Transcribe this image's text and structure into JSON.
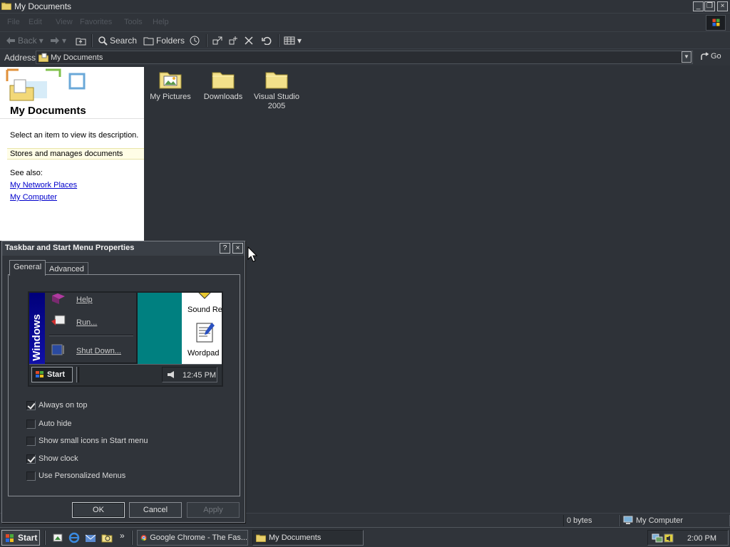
{
  "window": {
    "title": "My Documents",
    "caption_buttons": [
      "minimize",
      "restore",
      "close"
    ]
  },
  "menu": [
    "File",
    "Edit",
    "View",
    "Favorites",
    "Tools",
    "Help"
  ],
  "toolbar": {
    "back_label": "Back",
    "search_label": "Search",
    "folders_label": "Folders"
  },
  "address": {
    "label": "Address",
    "value": "My Documents",
    "go_label": "Go"
  },
  "taskpane": {
    "heading": "My Documents",
    "description": "Select an item to view its description.",
    "highlight": "Stores and manages documents",
    "see_also_label": "See also:",
    "links": [
      "My Network Places",
      "My Computer"
    ]
  },
  "folders": [
    {
      "name": "My Pictures",
      "icon": "pictures-folder-icon"
    },
    {
      "name": "Downloads",
      "icon": "folder-icon"
    },
    {
      "name": "Visual Studio 2005",
      "icon": "folder-icon"
    }
  ],
  "statusbar": {
    "size": "0 bytes",
    "zone": "My Computer"
  },
  "taskbar": {
    "start_label": "Start",
    "chevron": "»",
    "tasks": [
      {
        "label": "Google Chrome - The Fas...",
        "icon": "chrome-icon",
        "active": false
      },
      {
        "label": "My Documents",
        "icon": "folder-icon",
        "active": true
      }
    ],
    "clock": "2:00 PM"
  },
  "dialog": {
    "title": "Taskbar and Start Menu Properties",
    "help_button": "?",
    "close_button": "×",
    "tabs": [
      "General",
      "Advanced"
    ],
    "active_tab": "General",
    "preview": {
      "band_text": "Windows",
      "menu_items": [
        "Help",
        "Run...",
        "Shut Down..."
      ],
      "desktop_items": [
        "Sound Re",
        "Wordpad"
      ],
      "start_label": "Start",
      "clock": "12:45 PM"
    },
    "options": [
      {
        "label": "Always on top",
        "checked": true
      },
      {
        "label": "Auto hide",
        "checked": false
      },
      {
        "label": "Show small icons in Start menu",
        "checked": false
      },
      {
        "label": "Show clock",
        "checked": true
      },
      {
        "label": "Use Personalized Menus",
        "checked": false
      }
    ],
    "buttons": {
      "ok": "OK",
      "cancel": "Cancel",
      "apply": "Apply"
    }
  },
  "colors": {
    "background": "#2e3238",
    "taskpane": "#ffffff",
    "link": "#0000cc",
    "preview_desktop": "#008080",
    "folder_yellow": "#f2e08a"
  }
}
